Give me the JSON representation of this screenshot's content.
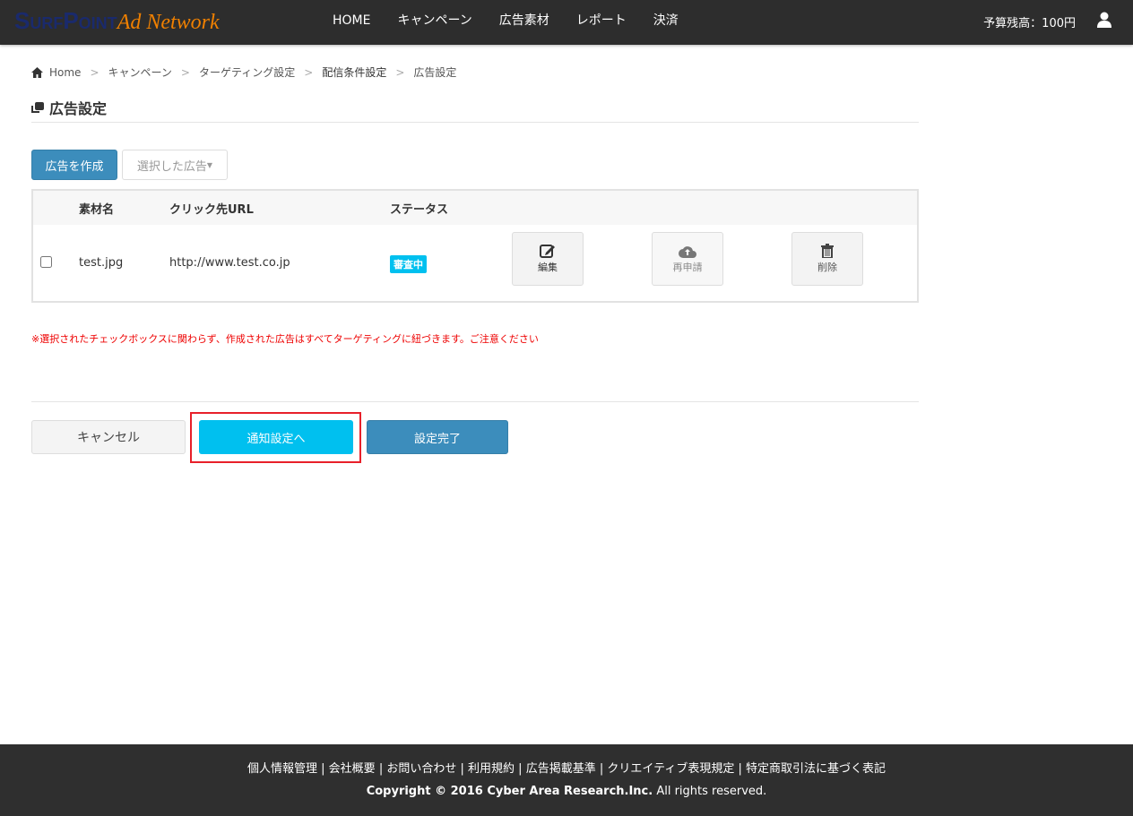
{
  "nav": {
    "logo_part1": "SurfPoint",
    "logo_part2": "Ad Network",
    "menu": [
      "HOME",
      "キャンペーン",
      "広告素材",
      "レポート",
      "決済"
    ],
    "budget": "予算残高：100円"
  },
  "breadcrumb": [
    "Home",
    "キャンペーン",
    "ターゲティング設定",
    "配信条件設定",
    "広告設定"
  ],
  "page_title": "広告設定",
  "toolbar": {
    "create": "広告を作成",
    "selected": "選択した広告"
  },
  "table": {
    "headers": [
      "素材名",
      "クリック先URL",
      "ステータス"
    ],
    "rows": [
      {
        "name": "test.jpg",
        "url": "http://www.test.co.jp",
        "status": "審査中",
        "actions": [
          "編集",
          "再申請",
          "削除"
        ]
      }
    ]
  },
  "note": "※選択されたチェックボックスに関わらず、作成された広告はすべてターゲティングに紐づきます。ご注意ください",
  "buttons": {
    "cancel": "キャンセル",
    "next": "通知設定へ",
    "done": "設定完了"
  },
  "footer": {
    "links": [
      "個人情報管理",
      "会社概要",
      "お問い合わせ",
      "利用規約",
      "広告掲載基準",
      "クリエイティブ表現規定",
      "特定商取引法に基づく表記"
    ],
    "copyright_bold": "Copyright © 2016 Cyber Area Research.Inc.",
    "copyright_rest": " All rights reserved."
  },
  "colors": {
    "primary": "#3c8dbc",
    "info": "#00c0ef",
    "highlight": "#e8202a"
  }
}
